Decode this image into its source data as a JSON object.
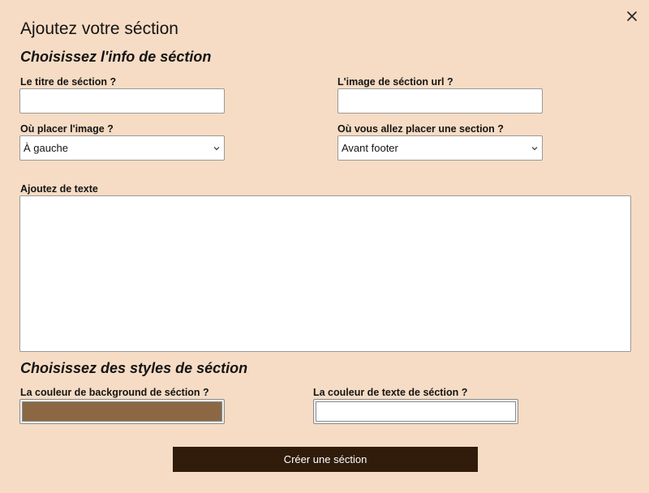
{
  "modal": {
    "title": "Ajoutez votre séction",
    "close_icon": "close-icon"
  },
  "info_section": {
    "heading": "Choisissez l'info de séction",
    "title_label": "Le titre de séction ?",
    "title_value": "",
    "image_url_label": "L'image de séction url ?",
    "image_url_value": "",
    "image_position_label": "Où placer l'image ?",
    "image_position_selected": "À gauche",
    "section_position_label": "Où vous allez placer une section ?",
    "section_position_selected": "Avant footer",
    "text_label": "Ajoutez de texte",
    "text_value": ""
  },
  "style_section": {
    "heading": "Choisissez des styles de séction",
    "bg_color_label": "La couleur de background de séction ?",
    "bg_color_value": "#8b6843",
    "text_color_label": "La couleur de texte de séction ?",
    "text_color_value": "#ffffff"
  },
  "submit": {
    "label": "Créer une séction"
  },
  "colors": {
    "background": "#f6dcc4",
    "button": "#311c0b"
  }
}
